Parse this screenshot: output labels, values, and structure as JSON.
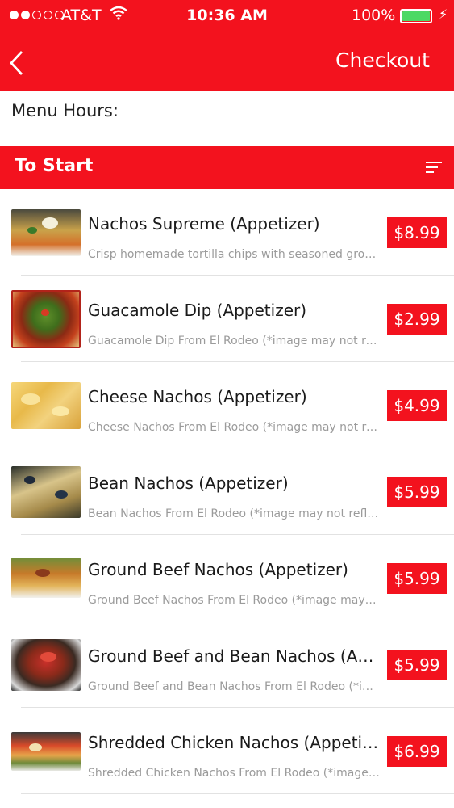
{
  "status_bar": {
    "carrier": "AT&T",
    "time": "10:36 AM",
    "battery_percent": "100%",
    "battery_level": 1.0
  },
  "nav": {
    "checkout_label": "Checkout",
    "back_icon": "chevron-left-icon"
  },
  "menu_hours_label": "Menu Hours:",
  "section": {
    "title": "To Start",
    "sort_icon": "sort-lines-icon"
  },
  "colors": {
    "accent": "#f3121e",
    "battery": "#4cd964"
  },
  "items": [
    {
      "title": "Nachos Supreme (Appetizer)",
      "description": "Crisp homemade tortilla chips with seasoned grou…",
      "price": "$8.99"
    },
    {
      "title": "Guacamole Dip (Appetizer)",
      "description": "Guacamole Dip From El Rodeo (*image may not re…",
      "price": "$2.99"
    },
    {
      "title": "Cheese Nachos (Appetizer)",
      "description": "Cheese Nachos From El Rodeo (*image may not re…",
      "price": "$4.99"
    },
    {
      "title": "Bean Nachos (Appetizer)",
      "description": "Bean Nachos From El Rodeo (*image may not refl…",
      "price": "$5.99"
    },
    {
      "title": "Ground Beef Nachos (Appetizer)",
      "description": "Ground Beef Nachos From El Rodeo (*image may…",
      "price": "$5.99"
    },
    {
      "title": "Ground Beef and Bean Nachos (App…",
      "description": "Ground Beef and Bean Nachos From El Rodeo (*i…",
      "price": "$5.99"
    },
    {
      "title": "Shredded Chicken Nachos (Appetizer)",
      "description": "Shredded Chicken Nachos From El Rodeo (*image…",
      "price": "$6.99"
    }
  ]
}
